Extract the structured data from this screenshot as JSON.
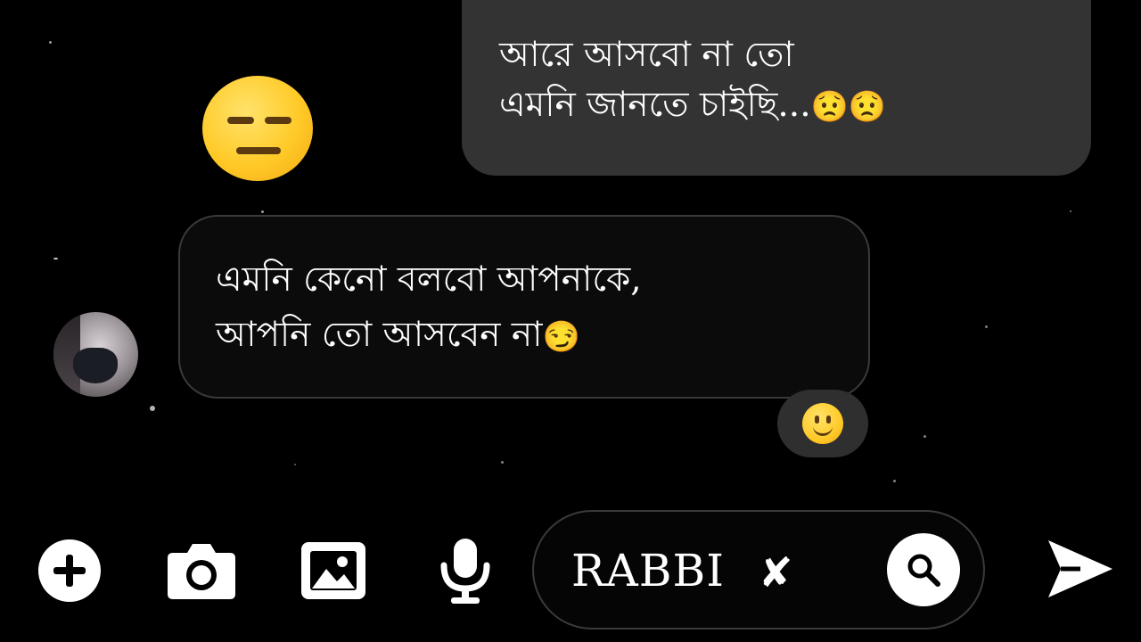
{
  "chat": {
    "outgoing_message": {
      "line1": "আরে আসবো না তো",
      "line2": "এমনি জানতে চাইছি...",
      "trailing_emojis": "😟😟"
    },
    "incoming_message": {
      "line1": "এমনি কেনো বলবো আপনাকে,",
      "line2": "আপনি তো আসবেন না",
      "trailing_emoji": "😏"
    },
    "reaction_emoji": "expressionless-face-icon",
    "message_reaction": "slightly-smiling-face-icon"
  },
  "composer": {
    "input_value": "RABBI",
    "clear_symbol": "✘"
  },
  "icons": {
    "add": "plus-circle-icon",
    "camera": "camera-icon",
    "gallery": "image-icon",
    "mic": "microphone-icon",
    "search": "search-icon",
    "send": "send-icon"
  },
  "colors": {
    "background": "#000000",
    "outgoing_bubble": "#333334",
    "incoming_bubble_border": "#3a3a3a",
    "icon": "#ffffff"
  }
}
